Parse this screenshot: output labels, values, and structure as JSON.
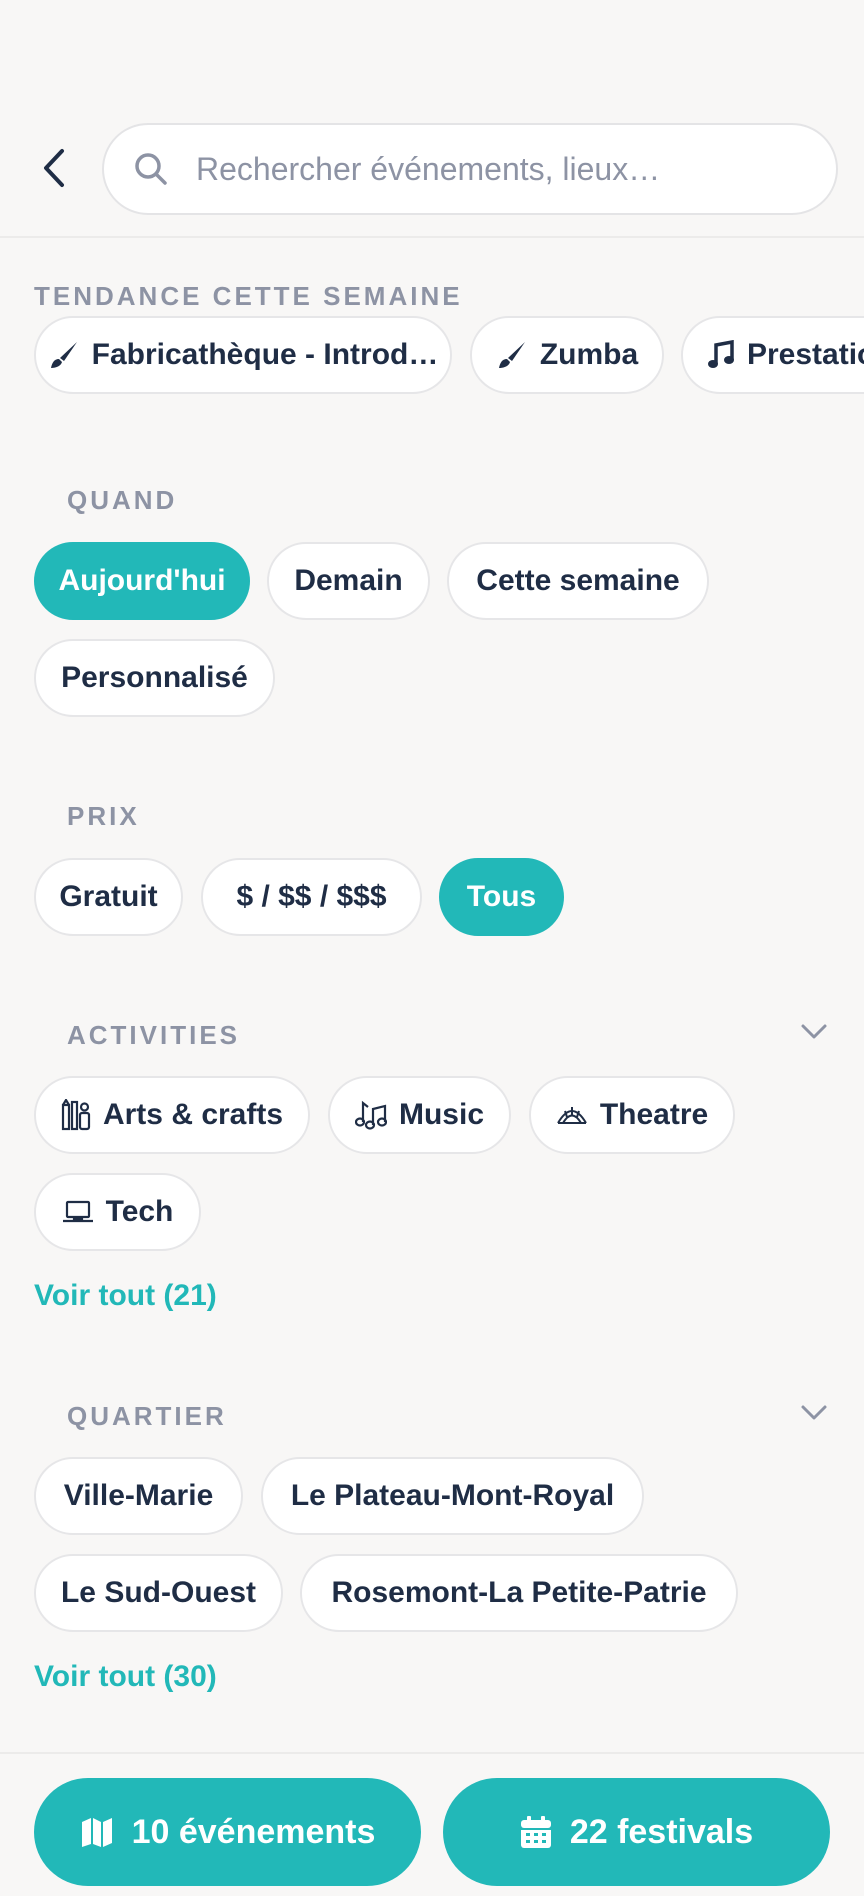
{
  "search": {
    "placeholder": "Rechercher événements, lieux…"
  },
  "trending": {
    "title": "TENDANCE CETTE SEMAINE",
    "items": [
      {
        "label": "Fabricathèque - Introd…",
        "icon": "paintbrush-icon"
      },
      {
        "label": "Zumba",
        "icon": "paintbrush-icon"
      },
      {
        "label": "Prestation",
        "icon": "music-note-icon"
      }
    ]
  },
  "when": {
    "title": "QUAND",
    "options": [
      "Aujourd'hui",
      "Demain",
      "Cette semaine",
      "Personnalisé"
    ],
    "selected": "Aujourd'hui"
  },
  "price": {
    "title": "PRIX",
    "options": [
      "Gratuit",
      "$ / $$ / $$$",
      "Tous"
    ],
    "selected": "Tous"
  },
  "activities": {
    "title": "ACTIVITIES",
    "items": [
      {
        "label": "Arts & crafts",
        "icon": "arts-crafts-icon"
      },
      {
        "label": "Music",
        "icon": "music-notes-icon"
      },
      {
        "label": "Theatre",
        "icon": "theatre-icon"
      },
      {
        "label": "Tech",
        "icon": "laptop-icon"
      }
    ],
    "see_all": "Voir tout (21)"
  },
  "neighbourhood": {
    "title": "QUARTIER",
    "items": [
      "Ville-Marie",
      "Le Plateau-Mont-Royal",
      "Le Sud-Ouest",
      "Rosemont-La Petite-Patrie"
    ],
    "see_all": "Voir tout (30)"
  },
  "footer": {
    "events_label": "10 événements",
    "festivals_label": "22 festivals"
  },
  "colors": {
    "accent": "#22b8b8",
    "text": "#1f2d45",
    "muted": "#8d93a4",
    "background": "#f8f7f6"
  }
}
